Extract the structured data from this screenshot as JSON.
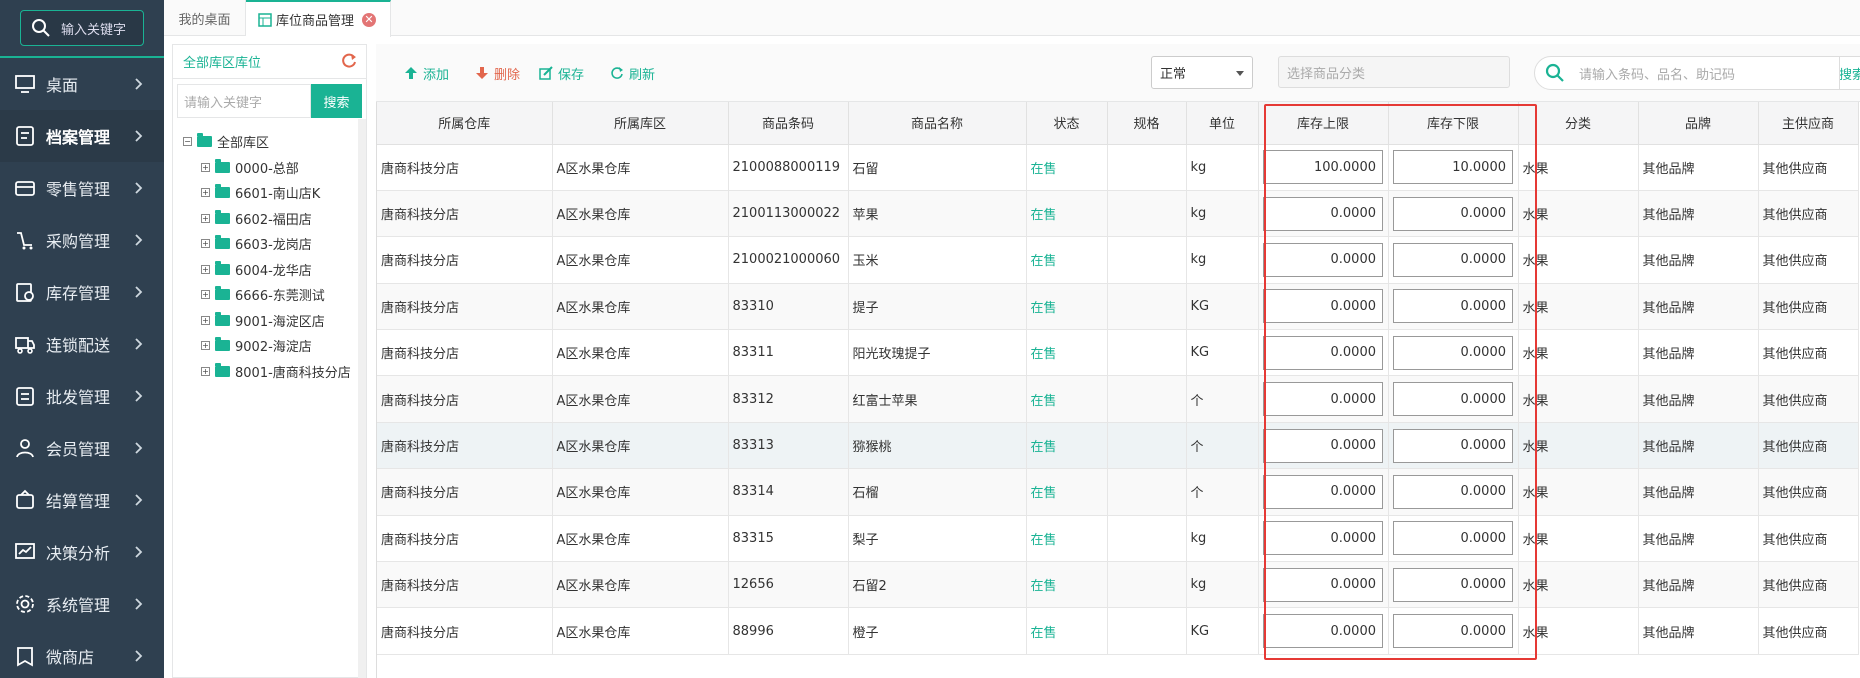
{
  "sidebar": {
    "search_placeholder": "输入关键字",
    "items": [
      {
        "label": "桌面",
        "icon": "monitor-icon"
      },
      {
        "label": "档案管理",
        "icon": "archive-icon",
        "active": true
      },
      {
        "label": "零售管理",
        "icon": "retail-icon"
      },
      {
        "label": "采购管理",
        "icon": "purchase-icon"
      },
      {
        "label": "库存管理",
        "icon": "inventory-icon"
      },
      {
        "label": "连锁配送",
        "icon": "truck-icon"
      },
      {
        "label": "批发管理",
        "icon": "wholesale-icon"
      },
      {
        "label": "会员管理",
        "icon": "member-icon"
      },
      {
        "label": "结算管理",
        "icon": "settlement-icon"
      },
      {
        "label": "决策分析",
        "icon": "chart-icon"
      },
      {
        "label": "系统管理",
        "icon": "gear-icon"
      },
      {
        "label": "微商店",
        "icon": "shop-icon"
      }
    ]
  },
  "tabs": {
    "home": "我的桌面",
    "current": "库位商品管理"
  },
  "tree": {
    "title": "全部库区库位",
    "search_placeholder": "请输入关键字",
    "search_button": "搜索",
    "root": "全部库区",
    "nodes": [
      "0000-总部",
      "6601-南山店K",
      "6602-福田店",
      "6603-龙岗店",
      "6004-龙华店",
      "6666-东莞测试",
      "9001-海淀区店",
      "9002-海淀店",
      "8001-唐商科技分店"
    ]
  },
  "toolbar": {
    "add": "添加",
    "delete": "删除",
    "save": "保存",
    "refresh": "刷新",
    "status_select": "正常",
    "category_placeholder": "选择商品分类",
    "search_placeholder": "请输入条码、品名、助记码",
    "search_button": "搜索"
  },
  "table": {
    "headers": [
      "所属仓库",
      "所属库区",
      "商品条码",
      "商品名称",
      "状态",
      "规格",
      "单位",
      "库存上限",
      "库存下限",
      "分类",
      "品牌",
      "主供应商"
    ],
    "rows": [
      [
        "唐商科技分店",
        "A区水果仓库",
        "2100088000119",
        "石留",
        "在售",
        "",
        "kg",
        "100.0000",
        "10.0000",
        "水果",
        "其他品牌",
        "其他供应商"
      ],
      [
        "唐商科技分店",
        "A区水果仓库",
        "2100113000022",
        "苹果",
        "在售",
        "",
        "kg",
        "0.0000",
        "0.0000",
        "水果",
        "其他品牌",
        "其他供应商"
      ],
      [
        "唐商科技分店",
        "A区水果仓库",
        "2100021000060",
        "玉米",
        "在售",
        "",
        "kg",
        "0.0000",
        "0.0000",
        "水果",
        "其他品牌",
        "其他供应商"
      ],
      [
        "唐商科技分店",
        "A区水果仓库",
        "83310",
        "提子",
        "在售",
        "",
        "KG",
        "0.0000",
        "0.0000",
        "水果",
        "其他品牌",
        "其他供应商"
      ],
      [
        "唐商科技分店",
        "A区水果仓库",
        "83311",
        "阳光玫瑰提子",
        "在售",
        "",
        "KG",
        "0.0000",
        "0.0000",
        "水果",
        "其他品牌",
        "其他供应商"
      ],
      [
        "唐商科技分店",
        "A区水果仓库",
        "83312",
        "红富士苹果",
        "在售",
        "",
        "个",
        "0.0000",
        "0.0000",
        "水果",
        "其他品牌",
        "其他供应商"
      ],
      [
        "唐商科技分店",
        "A区水果仓库",
        "83313",
        "猕猴桃",
        "在售",
        "",
        "个",
        "0.0000",
        "0.0000",
        "水果",
        "其他品牌",
        "其他供应商"
      ],
      [
        "唐商科技分店",
        "A区水果仓库",
        "83314",
        "石榴",
        "在售",
        "",
        "个",
        "0.0000",
        "0.0000",
        "水果",
        "其他品牌",
        "其他供应商"
      ],
      [
        "唐商科技分店",
        "A区水果仓库",
        "83315",
        "梨子",
        "在售",
        "",
        "kg",
        "0.0000",
        "0.0000",
        "水果",
        "其他品牌",
        "其他供应商"
      ],
      [
        "唐商科技分店",
        "A区水果仓库",
        "12656",
        "石留2",
        "在售",
        "",
        "kg",
        "0.0000",
        "0.0000",
        "水果",
        "其他品牌",
        "其他供应商"
      ],
      [
        "唐商科技分店",
        "A区水果仓库",
        "88996",
        "橙子",
        "在售",
        "",
        "KG",
        "0.0000",
        "0.0000",
        "水果",
        "其他品牌",
        "其他供应商"
      ]
    ]
  },
  "colors": {
    "accent": "#1ab394",
    "sidebar": "#2f4050",
    "delete": "#e2664c",
    "highlight_border": "#e53935"
  }
}
